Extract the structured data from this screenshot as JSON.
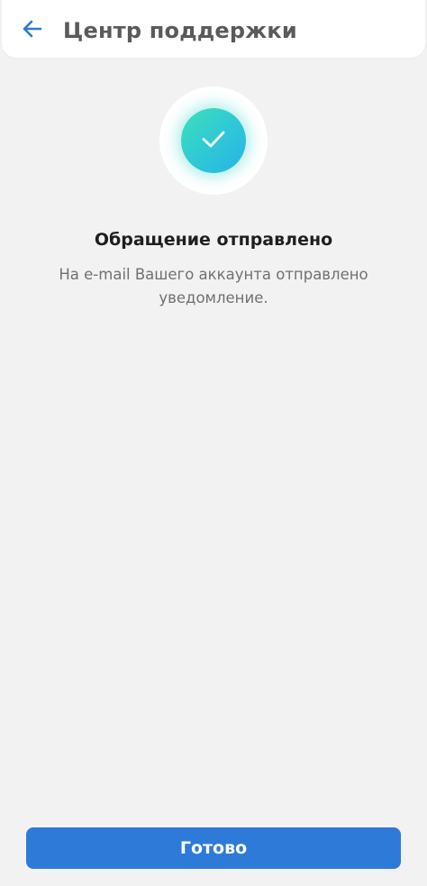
{
  "header": {
    "title": "Центр поддержки",
    "back_icon": "arrow-left-icon"
  },
  "status": {
    "icon": "checkmark-icon",
    "title": "Обращение отправлено",
    "message": "На e-mail Вашего аккаунта отправлено уведомление."
  },
  "footer": {
    "done_label": "Готово"
  },
  "colors": {
    "background": "#f2f2f2",
    "accent": "#2d7ad8",
    "success_gradient_start": "#3fe0b7",
    "success_gradient_end": "#28b3e4",
    "title_text": "#1f1f1f",
    "secondary_text": "#707070"
  }
}
